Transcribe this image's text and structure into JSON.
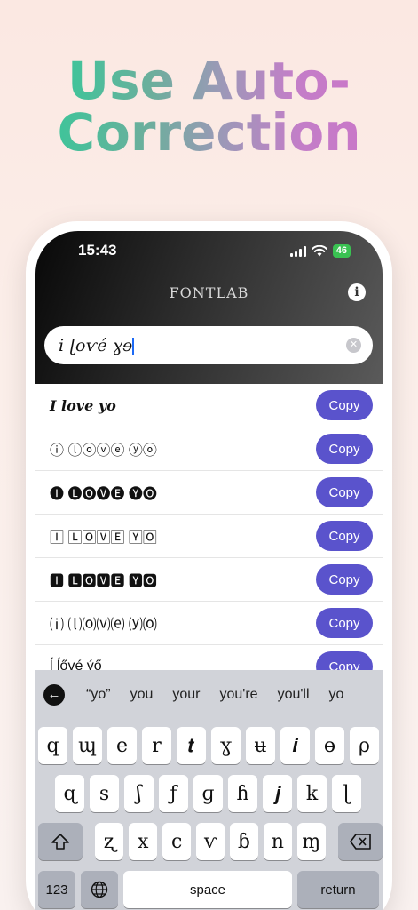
{
  "headline": {
    "line1": "Use Auto-",
    "line2": "Correction"
  },
  "status": {
    "time": "15:43",
    "battery": "46"
  },
  "app": {
    "title": "FONTLAB"
  },
  "search": {
    "value": "i ɭoѵé ɣɘ"
  },
  "copy_label": "Copy",
  "results": [
    "𝑰 𝒍𝒐𝒗𝒆 𝒚𝒐",
    "ⓘ ⓛⓞⓥⓔ ⓨⓞ",
    "🅘 🅛🅞🅥🅔 🅨🅞",
    "🄸 🄻🄾🅅🄴 🅈🄾",
    "🅸 🅻🅾🆅🅴 🆈🅾",
    "⒤ ⒧⒪⒱⒠ ⒴⒪",
    "ĺ ĺővé ýő"
  ],
  "suggestions": [
    "“yo”",
    "you",
    "your",
    "you're",
    "you'll",
    "yo"
  ],
  "keyboard": {
    "row1": [
      "q",
      "ɰ",
      "e",
      "r",
      "𝒕",
      "ɣ",
      "ʉ",
      "𝒊",
      "ɵ",
      "ρ"
    ],
    "row2": [
      "ɋ",
      "s",
      "ʃ",
      "ƒ",
      "ɡ",
      "ɦ",
      "𝒋",
      "k",
      "ɭ"
    ],
    "row3": [
      "ʐ",
      "x",
      "c",
      "ѵ",
      "ɓ",
      "n",
      "ɱ"
    ],
    "numbers": "123",
    "space": "space",
    "return": "return"
  }
}
